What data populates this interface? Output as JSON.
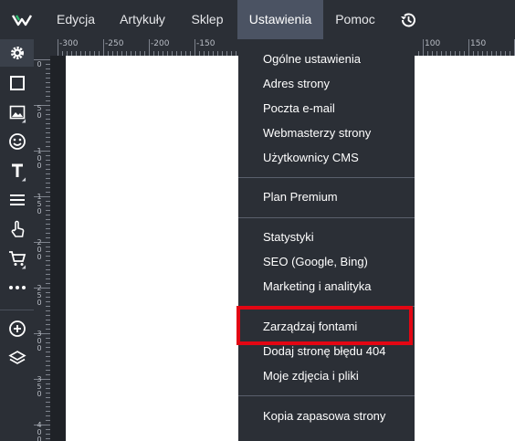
{
  "app": {
    "logo_icon": "webwave-logo-icon",
    "colors": {
      "bar": "#2b2f36",
      "active": "#4b5363",
      "highlight": "#e30613"
    }
  },
  "topmenu": {
    "items": [
      {
        "label": "Edycja"
      },
      {
        "label": "Artykuły"
      },
      {
        "label": "Sklep"
      },
      {
        "label": "Ustawienia",
        "active": true
      },
      {
        "label": "Pomoc"
      }
    ],
    "history_icon": "history-icon"
  },
  "sidebar": {
    "tools": [
      "settings-gear-icon",
      "box-icon",
      "image-icon",
      "emoji-icon",
      "text-icon",
      "menu-icon",
      "touch-hand-icon",
      "cart-icon",
      "more-icon",
      "add-circle-icon",
      "layers-icon"
    ]
  },
  "ruler": {
    "top_labels": [
      "-300",
      "-250",
      "-200",
      "-150",
      "100",
      "150"
    ],
    "left_labels": [
      "0",
      "5\n0",
      "1\n0\n0",
      "1\n5\n0",
      "2\n0\n0",
      "2\n5\n0",
      "3\n0\n0",
      "3\n5\n0",
      "4\n0\n0"
    ]
  },
  "dropdown": {
    "groups": [
      [
        "Ogólne ustawienia",
        "Adres strony",
        "Poczta e-mail",
        "Webmasterzy strony",
        "Użytkownicy CMS"
      ],
      [
        "Plan Premium"
      ],
      [
        "Statystyki",
        "SEO (Google, Bing)",
        "Marketing i analityka"
      ],
      [
        "Zarządzaj fontami",
        "Dodaj stronę błędu 404",
        "Moje zdjęcia i pliki"
      ],
      [
        "Kopia zapasowa strony"
      ]
    ],
    "highlighted_item": "Zarządzaj fontami"
  }
}
